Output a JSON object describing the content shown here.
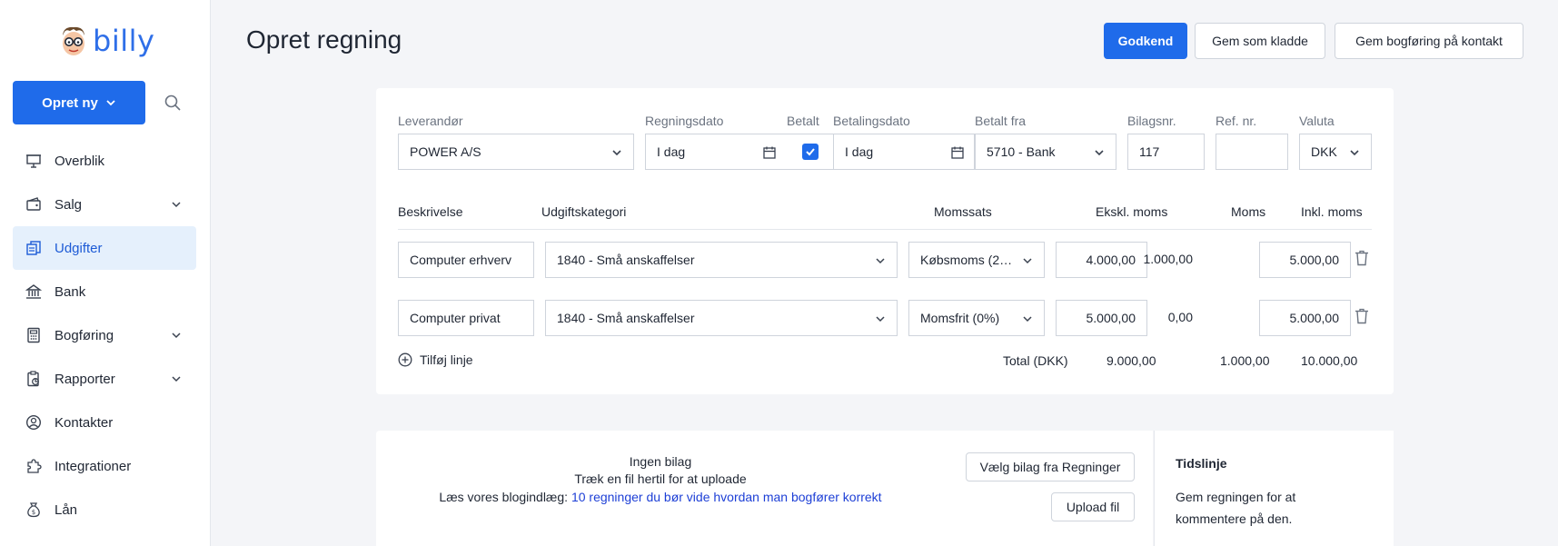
{
  "app": {
    "logo_text": "billy"
  },
  "sidebar": {
    "create_label": "Opret ny",
    "items": [
      {
        "label": "Overblik"
      },
      {
        "label": "Salg"
      },
      {
        "label": "Udgifter"
      },
      {
        "label": "Bank"
      },
      {
        "label": "Bogføring"
      },
      {
        "label": "Rapporter"
      },
      {
        "label": "Kontakter"
      },
      {
        "label": "Integrationer"
      },
      {
        "label": "Lån"
      }
    ]
  },
  "header": {
    "title": "Opret regning",
    "approve_label": "Godkend",
    "save_draft_label": "Gem som kladde",
    "save_booking_label": "Gem bogføring på kontakt"
  },
  "form": {
    "labels": {
      "supplier": "Leverandør",
      "bill_date": "Regningsdato",
      "paid": "Betalt",
      "payment_date": "Betalingsdato",
      "paid_from": "Betalt fra",
      "voucher_no": "Bilagsnr.",
      "ref_no": "Ref. nr.",
      "currency": "Valuta"
    },
    "values": {
      "supplier": "POWER A/S",
      "bill_date": "I dag",
      "paid": true,
      "payment_date": "I dag",
      "paid_from": "5710 - Bank",
      "voucher_no": "117",
      "ref_no": "",
      "currency": "DKK"
    }
  },
  "lines": {
    "headers": {
      "description": "Beskrivelse",
      "category": "Udgiftskategori",
      "vat_rate": "Momssats",
      "excl_vat": "Ekskl. moms",
      "vat": "Moms",
      "incl_vat": "Inkl. moms"
    },
    "rows": [
      {
        "description": "Computer erhverv",
        "category": "1840 - Små anskaffelser",
        "vat_rate": "Købsmoms (2…",
        "excl_vat": "4.000,00",
        "vat": "1.000,00",
        "incl_vat": "5.000,00"
      },
      {
        "description": "Computer privat",
        "category": "1840 - Små anskaffelser",
        "vat_rate": "Momsfrit (0%)",
        "excl_vat": "5.000,00",
        "vat": "0,00",
        "incl_vat": "5.000,00"
      }
    ],
    "add_line_label": "Tilføj linje",
    "total_label": "Total (DKK)",
    "total_excl": "9.000,00",
    "total_vat": "1.000,00",
    "total_incl": "10.000,00"
  },
  "attachments": {
    "no_voucher": "Ingen bilag",
    "drag_text": "Træk en fil hertil for at uploade",
    "blog_prefix": "Læs vores blogindlæg: ",
    "blog_link": "10 regninger du bør vide hvordan man bogfører korrekt",
    "choose_button": "Vælg bilag fra Regninger",
    "upload_button": "Upload fil"
  },
  "timeline": {
    "title": "Tidslinje",
    "text": "Gem regningen for at kommentere på den."
  },
  "colors": {
    "primary": "#1f6bea",
    "active_bg": "#e5f0fc",
    "link": "#1d3fd6"
  }
}
